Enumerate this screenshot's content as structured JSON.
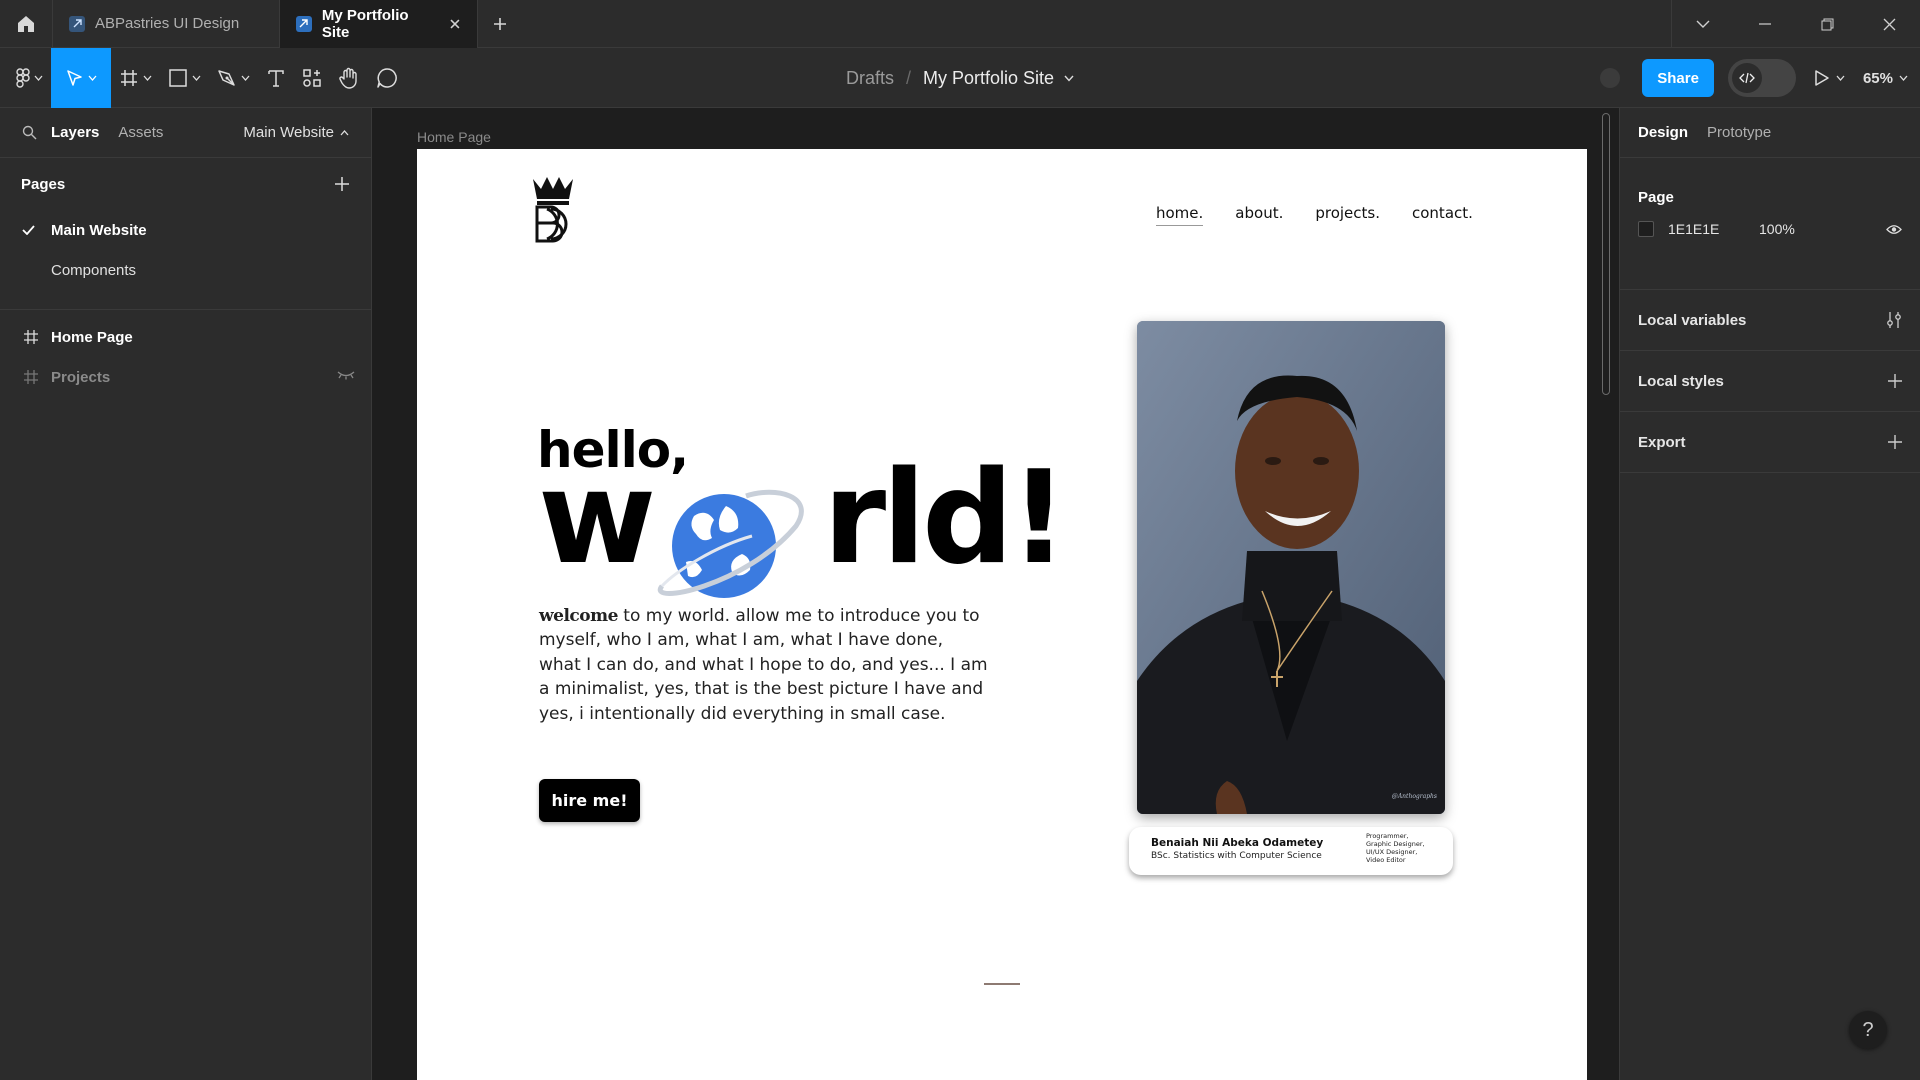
{
  "tabs": [
    {
      "title": "ABPastries UI Design",
      "active": false
    },
    {
      "title": "My Portfolio Site",
      "active": true
    }
  ],
  "toolbar": {
    "breadcrumb_root": "Drafts",
    "breadcrumb_separator": "/",
    "file_name": "My Portfolio Site",
    "share_label": "Share",
    "zoom": "65%",
    "accent_color": "#0d99ff"
  },
  "left_panel": {
    "tab_layers": "Layers",
    "tab_assets": "Assets",
    "current_page": "Main Website",
    "pages_heading": "Pages",
    "pages": [
      "Main Website",
      "Components"
    ],
    "layers": [
      {
        "name": "Home Page",
        "type": "frame",
        "hidden": false
      },
      {
        "name": "Projects",
        "type": "frame",
        "hidden": true
      }
    ]
  },
  "canvas": {
    "frame_label": "Home Page",
    "background": "#1e1e1e"
  },
  "site": {
    "nav": [
      "home.",
      "about.",
      "projects.",
      "contact."
    ],
    "hello": "hello,",
    "world_w": "w",
    "world_rest": "rld!",
    "intro_lead": "welcome",
    "intro_body": " to my world. allow me to introduce you to myself, who I am, what I am, what I have done, what I can do, and what I hope to do, and yes... I am a minimalist, yes, that is the best picture I have and yes, i intentionally did everything in small case.",
    "cta": "hire me!",
    "photo_watermark": "@Anthographs",
    "caption_name": "Benaiah Nii Abeka Odametey",
    "caption_degree": "BSc. Statistics with Computer Science",
    "caption_roles": [
      "Programmer,",
      "Graphic Designer,",
      "UI/UX Designer,",
      "Video Editor"
    ],
    "globe_color": "#3b7be0"
  },
  "right_panel": {
    "tab_design": "Design",
    "tab_prototype": "Prototype",
    "page_heading": "Page",
    "page_color_hex": "1E1E1E",
    "page_opacity": "100%",
    "local_variables": "Local variables",
    "local_styles": "Local styles",
    "export": "Export"
  },
  "help_label": "?"
}
